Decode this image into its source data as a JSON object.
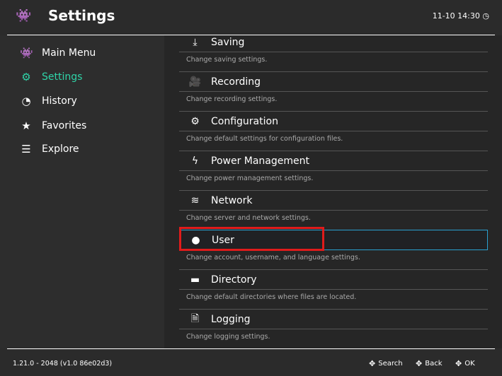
{
  "header": {
    "title": "Settings",
    "clock": "11-10 14:30",
    "logo_icon": "invader-icon",
    "clock_icon": "clock-icon"
  },
  "sidebar": {
    "active_color": "#2fd4a8",
    "items": [
      {
        "label": "Main Menu",
        "icon": "invader-icon"
      },
      {
        "label": "Settings",
        "icon": "gear-icon"
      },
      {
        "label": "History",
        "icon": "history-icon"
      },
      {
        "label": "Favorites",
        "icon": "star-icon"
      },
      {
        "label": "Explore",
        "icon": "database-icon"
      }
    ]
  },
  "entries": [
    {
      "title": "Saving",
      "desc": "Change saving settings.",
      "icon": "download-icon"
    },
    {
      "title": "Recording",
      "desc": "Change recording settings.",
      "icon": "camera-icon"
    },
    {
      "title": "Configuration",
      "desc": "Change default settings for configuration files.",
      "icon": "gears-icon"
    },
    {
      "title": "Power Management",
      "desc": "Change power management settings.",
      "icon": "bolt-icon"
    },
    {
      "title": "Network",
      "desc": "Change server and network settings.",
      "icon": "wifi-icon"
    },
    {
      "title": "User",
      "desc": "Change account, username, and language settings.",
      "icon": "user-icon"
    },
    {
      "title": "Directory",
      "desc": "Change default directories where files are located.",
      "icon": "folder-icon"
    },
    {
      "title": "Logging",
      "desc": "Change logging settings.",
      "icon": "file-icon"
    }
  ],
  "footer": {
    "version": "1.21.0 - 2048 (v1.0 86e02d3)",
    "hints": [
      "Search",
      "Back",
      "OK"
    ]
  }
}
